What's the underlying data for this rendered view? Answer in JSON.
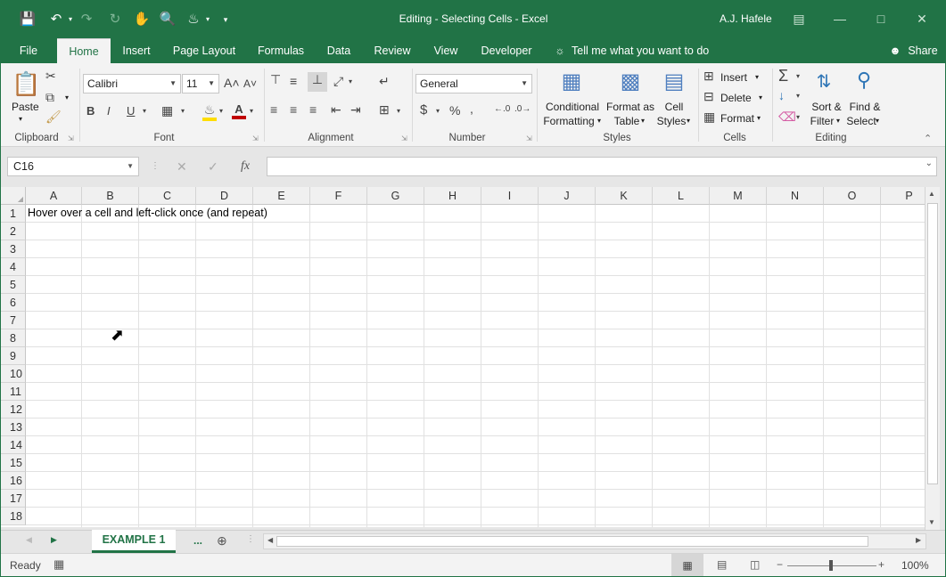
{
  "window": {
    "title": "Editing - Selecting Cells  -  Excel",
    "user": "A.J. Hafele"
  },
  "tabs": [
    "File",
    "Home",
    "Insert",
    "Page Layout",
    "Formulas",
    "Data",
    "Review",
    "View",
    "Developer"
  ],
  "tell_me": "Tell me what you want to do",
  "share": "Share",
  "ribbon": {
    "paste": "Paste",
    "font_name": "Calibri",
    "font_size": "11",
    "number_format": "General",
    "conditional_formatting": [
      "Conditional",
      "Formatting"
    ],
    "format_as_table": [
      "Format as",
      "Table"
    ],
    "cell_styles": [
      "Cell",
      "Styles"
    ],
    "insert": "Insert",
    "delete": "Delete",
    "format": "Format",
    "sort_filter": [
      "Sort &",
      "Filter"
    ],
    "find_select": [
      "Find &",
      "Select"
    ],
    "groups": [
      "Clipboard",
      "Font",
      "Alignment",
      "Number",
      "Styles",
      "Cells",
      "Editing"
    ]
  },
  "formula_bar": {
    "name_box": "C16",
    "value": ""
  },
  "columns": [
    "A",
    "B",
    "C",
    "D",
    "E",
    "F",
    "G",
    "H",
    "I",
    "J",
    "K",
    "L",
    "M",
    "N",
    "O",
    "P"
  ],
  "rows": [
    "1",
    "2",
    "3",
    "4",
    "5",
    "6",
    "7",
    "8",
    "9",
    "10",
    "11",
    "12",
    "13",
    "14",
    "15",
    "16",
    "17",
    "18"
  ],
  "cells": {
    "A1": "Hover over a cell and left-click once (and repeat)"
  },
  "sheet_tabs": [
    "EXAMPLE 1"
  ],
  "sheet_more": "...",
  "status": {
    "mode": "Ready",
    "zoom": "100%"
  },
  "colors": {
    "brand": "#217346",
    "ribbon_bg": "#f3f3f3",
    "grid_line": "#e1e1e1"
  }
}
